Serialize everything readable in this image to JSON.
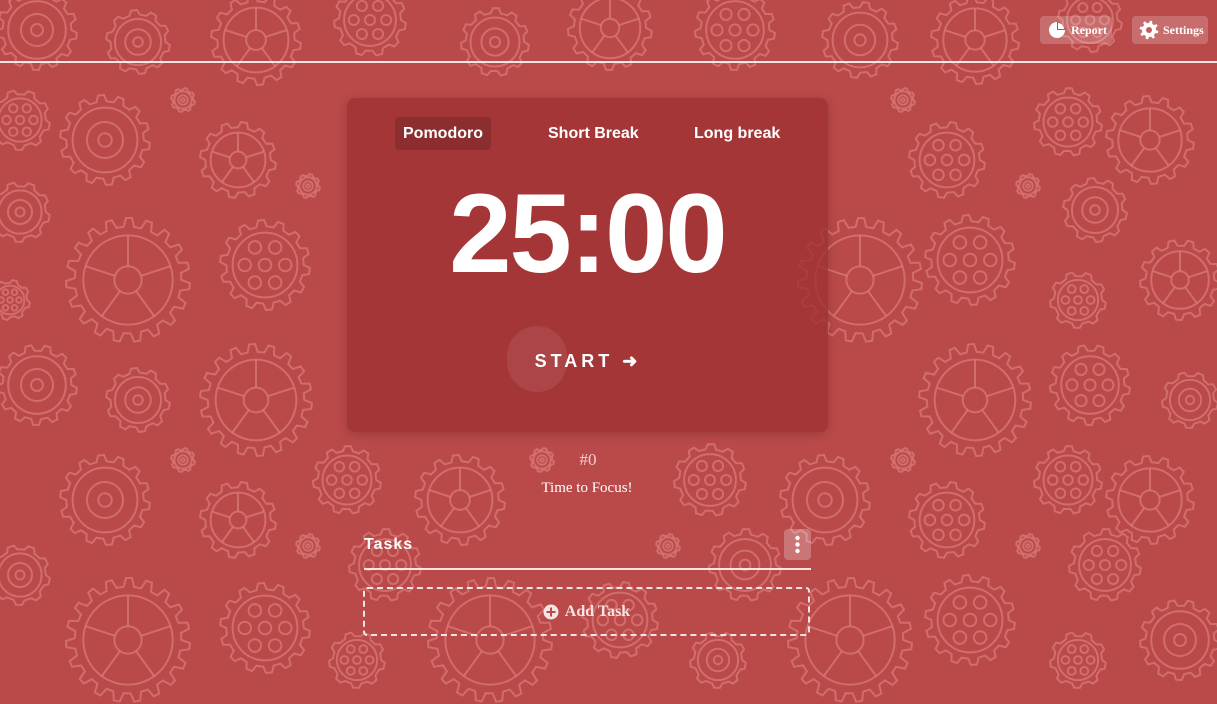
{
  "header": {
    "report_label": "Report",
    "settings_label": "Settings"
  },
  "timer": {
    "modes": [
      {
        "label": "Pomodoro",
        "active": true
      },
      {
        "label": "Short Break",
        "active": false
      },
      {
        "label": "Long break",
        "active": false
      }
    ],
    "time": "25:00",
    "start_label": "START ➜"
  },
  "session": {
    "counter": "#0",
    "message": "Time to Focus!"
  },
  "tasks": {
    "title": "Tasks",
    "add_label": "Add Task"
  },
  "colors": {
    "background": "#ba4949",
    "pattern": "#d97a7a",
    "text": "#ffffff"
  },
  "icons": {
    "report": "pie-chart-icon",
    "settings": "gear-icon",
    "tasks_menu": "kebab-menu-icon",
    "add_task": "plus-circle-icon"
  }
}
